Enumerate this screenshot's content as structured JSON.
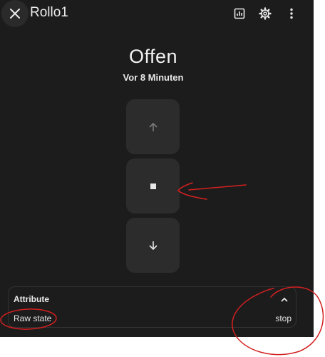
{
  "header": {
    "title": "Rollo1",
    "close_icon": "close-icon",
    "history_icon": "chart-icon",
    "settings_icon": "gear-icon",
    "menu_icon": "dots-vertical-icon"
  },
  "status": {
    "state": "Offen",
    "last_changed": "Vor 8 Minuten"
  },
  "controls": {
    "up_icon": "arrow-up-icon",
    "stop_icon": "stop-icon",
    "down_icon": "arrow-down-icon"
  },
  "attributes": {
    "title": "Attribute",
    "expand_icon": "chevron-up-icon",
    "rows": [
      {
        "label": "Raw state",
        "value": "stop"
      }
    ]
  },
  "colors": {
    "background": "#1c1c1c",
    "control": "#2c2c2c",
    "annotation": "#d42020"
  }
}
